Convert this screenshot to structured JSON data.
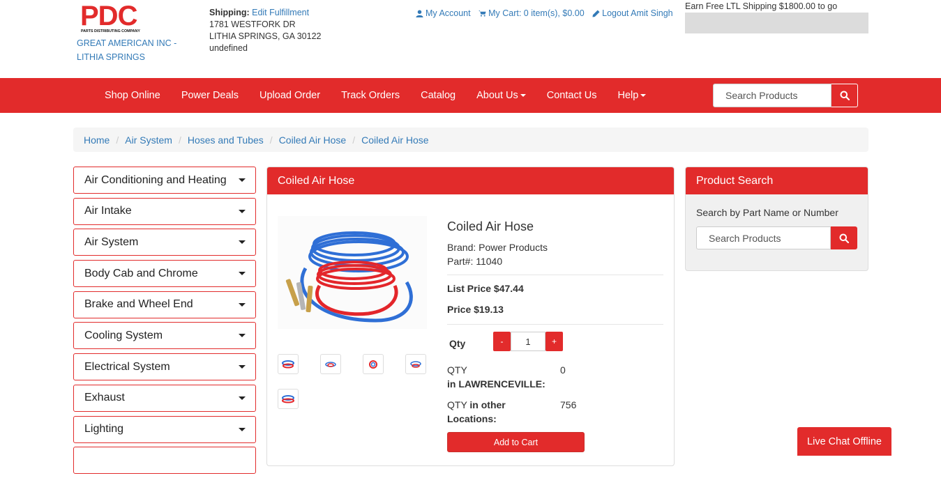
{
  "brand": {
    "logo_text": "PDC",
    "logo_subtext": "PARTS DISTRIBUTING COMPANY",
    "store_name": "GREAT AMERICAN INC - LITHIA SPRINGS",
    "colors": {
      "primary": "#e22b2b",
      "link": "#337ab7"
    }
  },
  "shipping": {
    "label": "Shipping:",
    "edit_link": "Edit Fulfillment",
    "address_line1": "1781 WESTFORK DR",
    "address_line2": "LITHIA SPRINGS, GA 30122",
    "address_line3": "undefined"
  },
  "account": {
    "my_account": "My Account",
    "my_cart": "My Cart: 0 item(s), $0.00",
    "logout": "Logout Amit Singh"
  },
  "ltl": {
    "text": "Earn Free LTL Shipping $1800.00 to go",
    "progress_fraction": 0
  },
  "nav": {
    "items": [
      {
        "label": "Shop Online",
        "dropdown": false
      },
      {
        "label": "Power Deals",
        "dropdown": false
      },
      {
        "label": "Upload Order",
        "dropdown": false
      },
      {
        "label": "Track Orders",
        "dropdown": false
      },
      {
        "label": "Catalog",
        "dropdown": false
      },
      {
        "label": "About Us",
        "dropdown": true
      },
      {
        "label": "Contact Us",
        "dropdown": false
      },
      {
        "label": "Help",
        "dropdown": true
      }
    ],
    "search_placeholder": "Search Products"
  },
  "breadcrumb": [
    "Home",
    "Air System",
    "Hoses and Tubes",
    "Coiled Air Hose",
    "Coiled Air Hose"
  ],
  "categories": [
    "Air Conditioning and Heating",
    "Air Intake",
    "Air System",
    "Body Cab and Chrome",
    "Brake and Wheel End",
    "Cooling System",
    "Electrical System",
    "Exhaust",
    "Lighting",
    ""
  ],
  "product": {
    "panel_title": "Coiled Air Hose",
    "name": "Coiled Air Hose",
    "brand": "Brand: Power Products",
    "part": "Part#: 11040",
    "list_price": "List Price $47.44",
    "price": "Price $19.13",
    "qty_label": "Qty",
    "qty_value": "1",
    "qty_minus": "-",
    "qty_plus": "+",
    "stock_local_label": "QTY",
    "stock_local_location": "in LAWRENCEVILLE:",
    "stock_local_value": "0",
    "stock_other_label": "QTY",
    "stock_other_suffix": "in other",
    "stock_other_location": "Locations:",
    "stock_other_value": "756",
    "add_to_cart": "Add to Cart",
    "thumbnail_count": 5
  },
  "product_search": {
    "title": "Product Search",
    "label": "Search by Part Name or Number",
    "placeholder": "Search Products"
  },
  "live_chat": "Live Chat Offline"
}
